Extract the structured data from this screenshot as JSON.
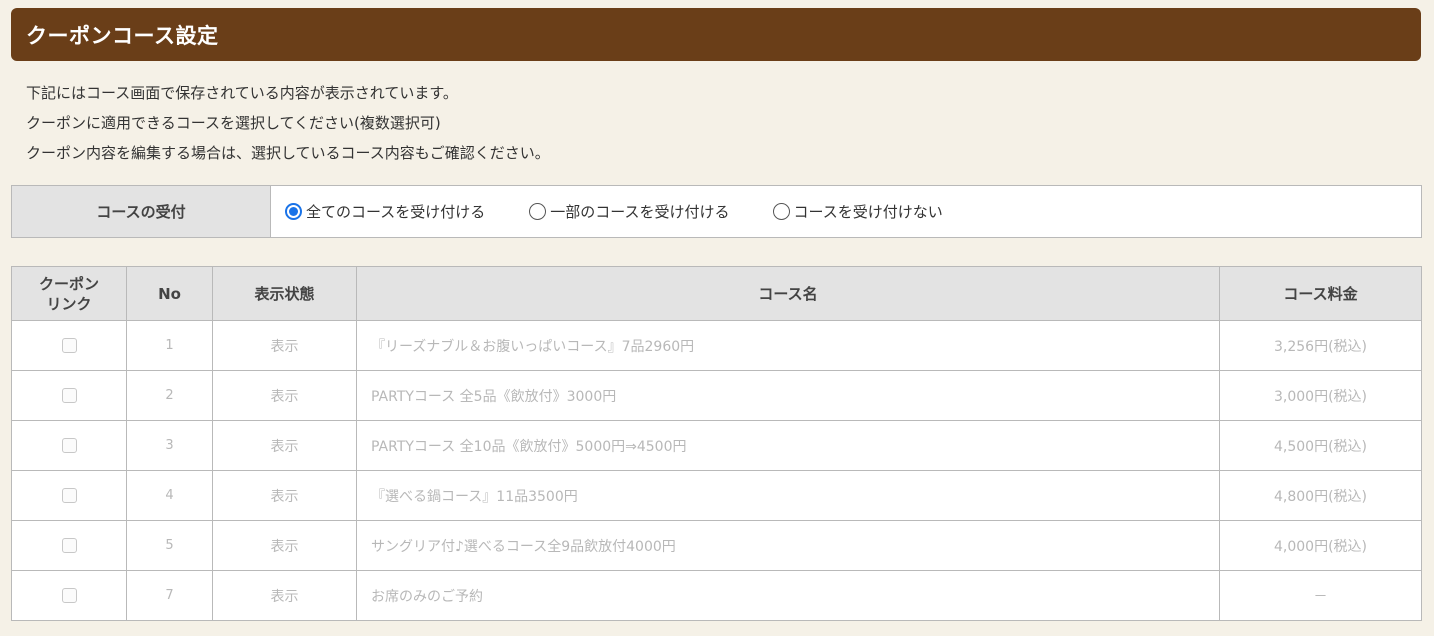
{
  "header": {
    "title": "クーポンコース設定"
  },
  "description": [
    "下記にはコース画面で保存されている内容が表示されています。",
    "クーポンに適用できるコースを選択してください(複数選択可)",
    "クーポン内容を編集する場合は、選択しているコース内容もご確認ください。"
  ],
  "acceptance": {
    "label": "コースの受付",
    "options": [
      {
        "label": "全てのコースを受け付ける",
        "checked": true
      },
      {
        "label": "一部のコースを受け付ける",
        "checked": false
      },
      {
        "label": "コースを受け付けない",
        "checked": false
      }
    ]
  },
  "table": {
    "headers": {
      "coupon_link": "クーポン\nリンク",
      "no": "No",
      "status": "表示状態",
      "name": "コース名",
      "price": "コース料金"
    },
    "rows": [
      {
        "no": "1",
        "status": "表示",
        "name": "『リーズナブル＆お腹いっぱいコース』7品2960円",
        "price": "3,256円(税込)",
        "checked": false
      },
      {
        "no": "2",
        "status": "表示",
        "name": "PARTYコース 全5品《飲放付》3000円",
        "price": "3,000円(税込)",
        "checked": false
      },
      {
        "no": "3",
        "status": "表示",
        "name": "PARTYコース 全10品《飲放付》5000円⇒4500円",
        "price": "4,500円(税込)",
        "checked": false
      },
      {
        "no": "4",
        "status": "表示",
        "name": "『選べる鍋コース』11品3500円",
        "price": "4,800円(税込)",
        "checked": false
      },
      {
        "no": "5",
        "status": "表示",
        "name": "サングリア付♪選べるコース全9品飲放付4000円",
        "price": "4,000円(税込)",
        "checked": false
      },
      {
        "no": "7",
        "status": "表示",
        "name": "お席のみのご予約",
        "price": "－",
        "checked": false
      }
    ]
  },
  "colors": {
    "header_bg": "#6a3e18",
    "page_bg": "#f5f1e7",
    "radio_accent": "#1a73e8",
    "disabled_text": "#b8b8b8"
  }
}
